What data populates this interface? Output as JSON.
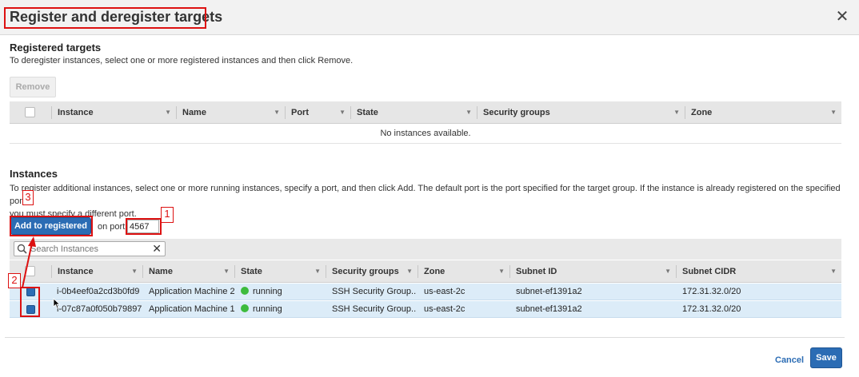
{
  "dialog": {
    "title": "Register and deregister targets",
    "close_icon": "close-icon"
  },
  "registered": {
    "heading": "Registered targets",
    "description": "To deregister instances, select one or more registered instances and then click Remove.",
    "remove_label": "Remove",
    "columns": [
      "Instance",
      "Name",
      "Port",
      "State",
      "Security groups",
      "Zone"
    ],
    "empty_message": "No instances available."
  },
  "instances": {
    "heading": "Instances",
    "description_line1": "To register additional instances, select one or more running instances, specify a port, and then click Add. The default port is the port specified for the target group. If the instance is already registered on the specified port,",
    "description_line2": "you must specify a different port.",
    "add_label": "Add to registered",
    "on_port_label": "on port",
    "port_value": "4567",
    "search_placeholder": "Search Instances",
    "columns": [
      "Instance",
      "Name",
      "State",
      "Security groups",
      "Zone",
      "Subnet ID",
      "Subnet CIDR"
    ],
    "rows": [
      {
        "instance": "i-0b4eef0a2cd3b0fd9",
        "name": "Application Machine 2",
        "state": "running",
        "security_groups": "SSH Security Group...",
        "zone": "us-east-2c",
        "subnet_id": "subnet-ef1391a2",
        "subnet_cidr": "172.31.32.0/20",
        "selected": true
      },
      {
        "instance": "i-07c87a0f050b79897",
        "name": "Application Machine 1",
        "state": "running",
        "security_groups": "SSH Security Group...",
        "zone": "us-east-2c",
        "subnet_id": "subnet-ef1391a2",
        "subnet_cidr": "172.31.32.0/20",
        "selected": true
      }
    ]
  },
  "footer": {
    "cancel_label": "Cancel",
    "save_label": "Save"
  },
  "annotations": [
    "1",
    "2",
    "3"
  ],
  "colors": {
    "accent": "#2b6cb4",
    "annotation": "#dd1111",
    "running": "#3dbb3d",
    "selected_row": "#dcecf8"
  }
}
